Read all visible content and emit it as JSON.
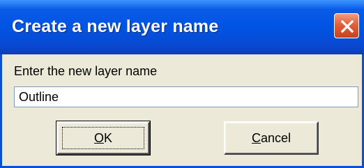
{
  "dialog": {
    "title": "Create a new layer name",
    "close_icon": "close-icon",
    "prompt": "Enter the new layer name",
    "input_value": "Outline",
    "ok_mnemonic": "O",
    "ok_rest": "K",
    "cancel_mnemonic": "C",
    "cancel_rest": "ancel"
  },
  "colors": {
    "titlebar": "#0054e3",
    "face": "#ece9d8",
    "close_button": "#e0603a"
  }
}
